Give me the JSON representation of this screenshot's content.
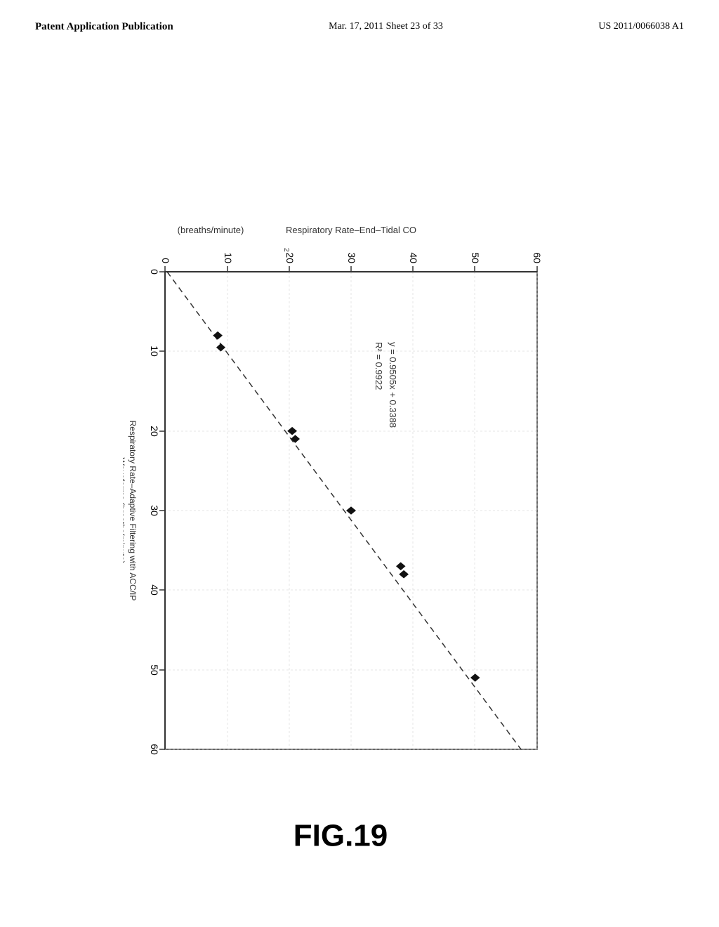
{
  "header": {
    "left_label": "Patent Application Publication",
    "center_label": "Mar. 17, 2011  Sheet 23 of 33",
    "right_label": "US 2011/0066038 A1"
  },
  "fig_label": "FIG.19",
  "chart": {
    "title_xaxis": "Respiratory Rate–Adaptive Filtering with ACC/IP\nWaveforms (breaths/minute)",
    "title_yaxis": "Respiratory Rate–End–Tidal CO₂ (breaths/minute)",
    "equation_line1": "y = 0.9505x + 0.3388",
    "equation_line2": "R² = 0.9922",
    "x_ticks": [
      0,
      10,
      20,
      30,
      40,
      50,
      60
    ],
    "y_ticks": [
      0,
      10,
      20,
      30,
      40,
      50,
      60
    ],
    "data_points": [
      {
        "x": 8,
        "y": 8.5
      },
      {
        "x": 9.5,
        "y": 9
      },
      {
        "x": 20,
        "y": 20.5
      },
      {
        "x": 21,
        "y": 21
      },
      {
        "x": 30,
        "y": 30
      },
      {
        "x": 37,
        "y": 38
      },
      {
        "x": 38,
        "y": 38.5
      },
      {
        "x": 51,
        "y": 50
      }
    ]
  }
}
